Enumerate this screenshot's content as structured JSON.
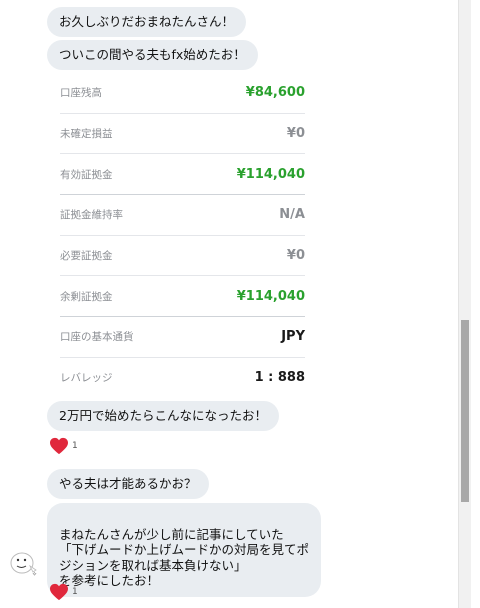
{
  "messages": {
    "m1": "お久しぶりだおまねたんさん！",
    "m2": "ついこの間やる夫もfx始めたお！",
    "m3": "2万円で始めたらこんなになったお！",
    "m4": "やる夫は才能あるかお？",
    "m5": "まねたんさんが少し前に記事にしていた\n「下げムードか上げムードかの対局を見てポ\nジションを取れば基本負けない」\nを参考にしたお！"
  },
  "account": {
    "rows": [
      {
        "label": "口座残高",
        "value": "¥84,600"
      },
      {
        "label": "未確定損益",
        "value": "¥0"
      },
      {
        "label": "有効証拠金",
        "value": "¥114,040"
      },
      {
        "label": "証拠金維持率",
        "value": "N/A"
      },
      {
        "label": "必要証拠金",
        "value": "¥0"
      },
      {
        "label": "余剰証拠金",
        "value": "¥114,040"
      },
      {
        "label": "口座の基本通貨",
        "value": "JPY"
      },
      {
        "label": "レバレッジ",
        "value": "1 : 888"
      }
    ]
  },
  "reactions": {
    "r1": {
      "icon": "heart-icon",
      "count": "1"
    },
    "r2": {
      "icon": "heart-icon",
      "count": "1"
    }
  },
  "colors": {
    "bubble": "#e9edf1",
    "green_value": "#2aa12e",
    "heart": "#e0283c"
  }
}
